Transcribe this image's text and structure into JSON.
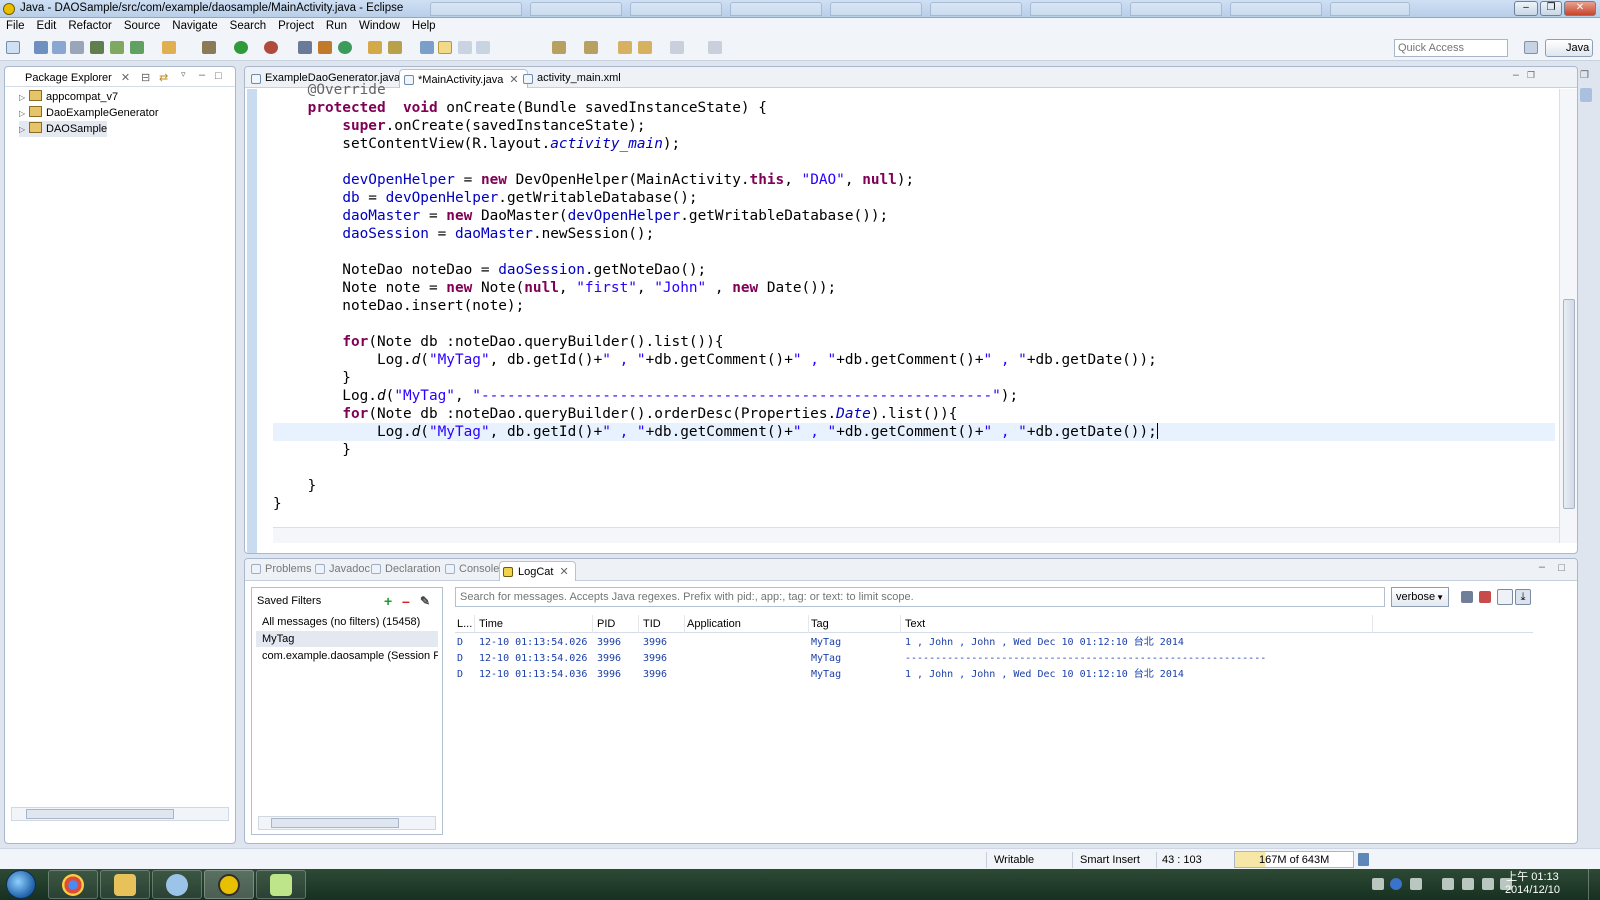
{
  "window": {
    "title": "Java - DAOSample/src/com/example/daosample/MainActivity.java - Eclipse"
  },
  "menu": [
    "File",
    "Edit",
    "Refactor",
    "Source",
    "Navigate",
    "Search",
    "Project",
    "Run",
    "Window",
    "Help"
  ],
  "toolbar": {
    "quick_access_placeholder": "Quick Access",
    "perspective": "Java"
  },
  "package_explorer": {
    "title": "Package Explorer",
    "projects": [
      "appcompat_v7",
      "DaoExampleGenerator",
      "DAOSample"
    ]
  },
  "editor": {
    "tabs": [
      "ExampleDaoGenerator.java",
      "*MainActivity.java",
      "activity_main.xml"
    ],
    "active_tab": 1
  },
  "bottom": {
    "tabs": [
      "Problems",
      "Javadoc",
      "Declaration",
      "Console",
      "LogCat"
    ],
    "active_tab": 4,
    "filters_title": "Saved Filters",
    "filters": [
      "All messages (no filters) (15458)",
      "MyTag",
      "com.example.daosample (Session Filter)"
    ],
    "search_placeholder": "Search for messages. Accepts Java regexes. Prefix with pid:, app:, tag: or text: to limit scope.",
    "level": "verbose",
    "columns": [
      "L...",
      "Time",
      "PID",
      "TID",
      "Application",
      "Tag",
      "Text"
    ],
    "rows": [
      {
        "level": "D",
        "time": "12-10 01:13:54.026",
        "pid": "3996",
        "tid": "3996",
        "app": "",
        "tag": "MyTag",
        "text": "1 , John , John , Wed Dec 10 01:12:10 台北 2014"
      },
      {
        "level": "D",
        "time": "12-10 01:13:54.026",
        "pid": "3996",
        "tid": "3996",
        "app": "",
        "tag": "MyTag",
        "text": "------------------------------------------------------------"
      },
      {
        "level": "D",
        "time": "12-10 01:13:54.036",
        "pid": "3996",
        "tid": "3996",
        "app": "",
        "tag": "MyTag",
        "text": "1 , John , John , Wed Dec 10 01:12:10 台北 2014"
      }
    ]
  },
  "status": {
    "writable": "Writable",
    "insert_mode": "Smart Insert",
    "position": "43 : 103",
    "heap": "167M of 643M"
  },
  "taskbar": {
    "time": "上午 01:13",
    "date": "2014/12/10"
  },
  "colors": {
    "keyword": "#7f0055",
    "field": "#0000c0",
    "string": "#2a00ff",
    "log_text": "#1a3fa8"
  }
}
